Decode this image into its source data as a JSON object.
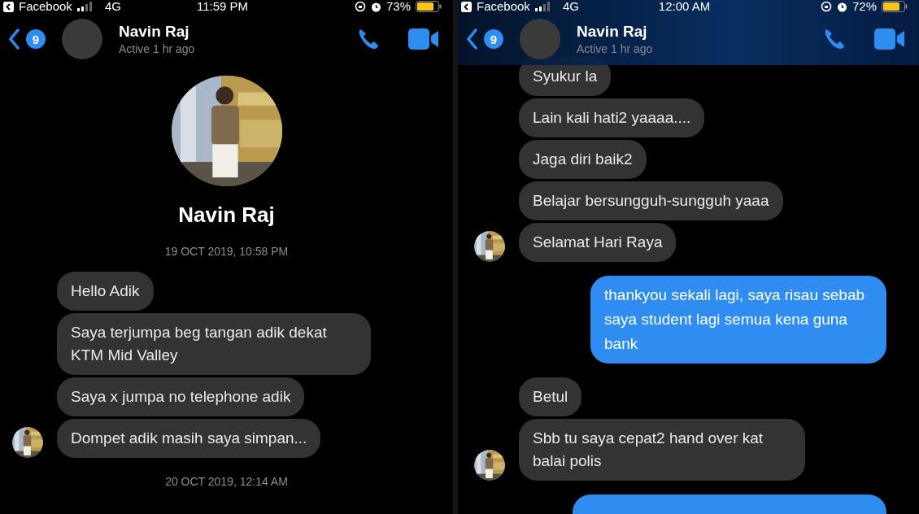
{
  "panels": [
    {
      "status_bar": {
        "back_app": "Facebook",
        "network": "4G",
        "time": "11:59 PM",
        "battery": "73%"
      },
      "header": {
        "translucent": false,
        "unread_count": "9",
        "name": "Navin Raj",
        "status": "Active 1 hr ago"
      },
      "profile": {
        "name": "Navin Raj"
      },
      "messages": [
        {
          "kind": "timestamp",
          "text": "19 OCT 2019, 10:58 PM"
        },
        {
          "kind": "received",
          "text": "Hello  Adik",
          "avatar": false
        },
        {
          "kind": "received",
          "text": "Saya terjumpa beg tangan adik dekat KTM Mid Valley",
          "avatar": false
        },
        {
          "kind": "received",
          "text": "Saya x jumpa no telephone adik",
          "avatar": false
        },
        {
          "kind": "received",
          "text": "Dompet adik masih saya simpan...",
          "avatar": true
        },
        {
          "kind": "timestamp",
          "text": "20 OCT 2019, 12:14 AM"
        }
      ]
    },
    {
      "status_bar": {
        "back_app": "Facebook",
        "network": "4G",
        "time": "12:00 AM",
        "battery": "72%"
      },
      "header": {
        "translucent": true,
        "unread_count": "9",
        "name": "Navin Raj",
        "status": "Active 1 hr ago"
      },
      "messages": [
        {
          "kind": "received",
          "text": "Syukur la",
          "avatar": false
        },
        {
          "kind": "received",
          "text": "Lain kali hati2 yaaaa....",
          "avatar": false
        },
        {
          "kind": "received",
          "text": "Jaga diri baik2",
          "avatar": false
        },
        {
          "kind": "received",
          "text": "Belajar bersungguh-sungguh yaaa",
          "avatar": false
        },
        {
          "kind": "received",
          "text": "Selamat Hari Raya",
          "avatar": true
        },
        {
          "kind": "sent",
          "text": "thankyou sekali lagi, saya risau sebab saya student lagi semua kena guna bank"
        },
        {
          "kind": "received",
          "text": "Betul",
          "avatar": false
        },
        {
          "kind": "received",
          "text": "Sbb tu saya cepat2 hand over kat balai polis",
          "avatar": true
        },
        {
          "kind": "sent_cut"
        }
      ]
    }
  ]
}
